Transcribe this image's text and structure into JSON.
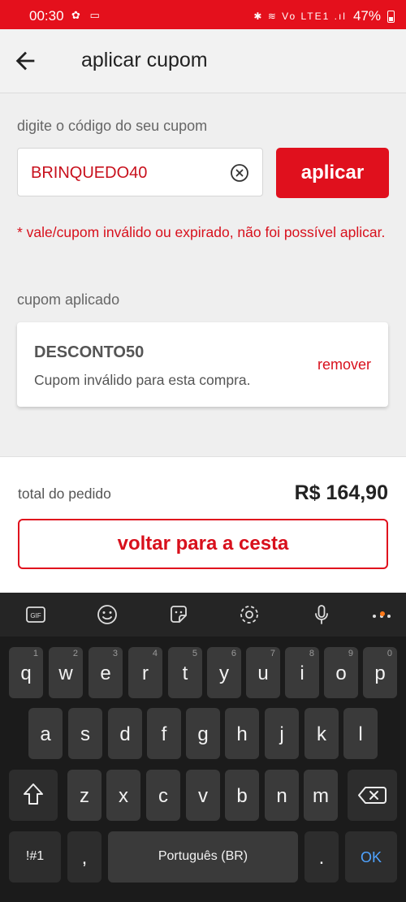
{
  "status_bar": {
    "time": "00:30",
    "battery": "47%",
    "notif_icons": "✿ ▭",
    "sys_icons": "✱ ≋ Vo LTE1 .ıl"
  },
  "appbar": {
    "title": "aplicar cupom",
    "back_icon": "arrow-left-icon"
  },
  "coupon_form": {
    "label": "digite o código do seu cupom",
    "input_value": "BRINQUEDO40",
    "apply_label": "aplicar",
    "error_message": "* vale/cupom inválido ou expirado, não foi possível aplicar."
  },
  "applied_coupon": {
    "section_label": "cupom aplicado",
    "code": "DESCONTO50",
    "message": "Cupom inválido para esta compra.",
    "remove_label": "remover"
  },
  "footer": {
    "total_label": "total do pedido",
    "total_value": "R$ 164,90",
    "back_to_cart_label": "voltar para a cesta"
  },
  "keyboard": {
    "row1": [
      {
        "key": "q",
        "hint": "1"
      },
      {
        "key": "w",
        "hint": "2"
      },
      {
        "key": "e",
        "hint": "3"
      },
      {
        "key": "r",
        "hint": "4"
      },
      {
        "key": "t",
        "hint": "5"
      },
      {
        "key": "y",
        "hint": "6"
      },
      {
        "key": "u",
        "hint": "7"
      },
      {
        "key": "i",
        "hint": "8"
      },
      {
        "key": "o",
        "hint": "9"
      },
      {
        "key": "p",
        "hint": "0"
      }
    ],
    "row2": [
      "a",
      "s",
      "d",
      "f",
      "g",
      "h",
      "j",
      "k",
      "l"
    ],
    "row3": [
      "z",
      "x",
      "c",
      "v",
      "b",
      "n",
      "m"
    ],
    "symbols_label": "!#1",
    "comma_label": ",",
    "space_label": "Português (BR)",
    "period_label": ".",
    "ok_label": "OK",
    "toolbar_gif_label": "GIF"
  },
  "colors": {
    "brand_red": "#e0101d",
    "error_red": "#d8101c"
  }
}
